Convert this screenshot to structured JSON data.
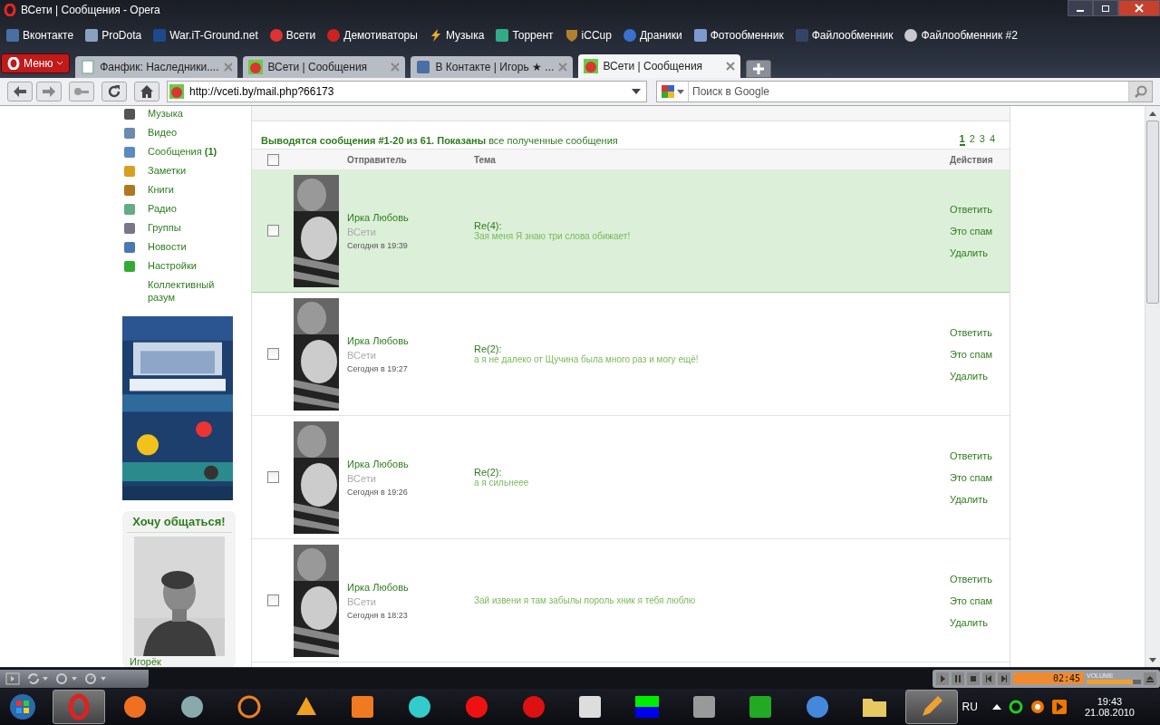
{
  "window": {
    "title": "ВСети | Сообщения - Opera"
  },
  "bookmarks": [
    {
      "label": "Вконтакте"
    },
    {
      "label": "ProDota"
    },
    {
      "label": "War.iT-Ground.net"
    },
    {
      "label": "Всети"
    },
    {
      "label": "Демотиваторы"
    },
    {
      "label": "Музыка"
    },
    {
      "label": "Торрент"
    },
    {
      "label": "iCCup"
    },
    {
      "label": "Драники"
    },
    {
      "label": "Фотообменник"
    },
    {
      "label": "Файлообменник"
    },
    {
      "label": "Файлообменник #2"
    }
  ],
  "menu_button": {
    "label": "Меню"
  },
  "tabs": [
    {
      "title": "Фанфик: Наследники....",
      "selected": false
    },
    {
      "title": "ВСети | Сообщения",
      "selected": false
    },
    {
      "title": "В Контакте | Игорь ★ ...",
      "selected": false
    },
    {
      "title": "ВСети | Сообщения",
      "selected": true
    }
  ],
  "address_bar": {
    "url": "http://vceti.by/mail.php?66173"
  },
  "search": {
    "placeholder": "Поиск в Google"
  },
  "sidebar": {
    "items": [
      {
        "label": "Музыка"
      },
      {
        "label": "Видео"
      },
      {
        "label": "Сообщения **(1)**"
      },
      {
        "label": "Заметки"
      },
      {
        "label": "Книги"
      },
      {
        "label": "Радио"
      },
      {
        "label": "Группы"
      },
      {
        "label": "Новости"
      },
      {
        "label": "Настройки"
      },
      {
        "label": "Коллективный разум"
      }
    ]
  },
  "promo": {
    "title": "Хочу общаться!",
    "name": "Игорёк"
  },
  "messages": {
    "summary": "**Выводятся сообщения #1-20 из 61. Показаны** все полученные сообщения",
    "pages": [
      {
        "label": "1",
        "selected": true
      },
      {
        "label": "2",
        "selected": false
      },
      {
        "label": "3",
        "selected": false
      },
      {
        "label": "4",
        "selected": false
      }
    ],
    "select_all_checked": false,
    "columns": [
      "Отправитель",
      "Тема",
      "Действия"
    ],
    "rows": [
      {
        "unread": true,
        "checked": false,
        "sender": "Ирка Любовь",
        "network": "ВСети",
        "date": "Сегодня в 19:39",
        "subject": "Re(4):",
        "text": "Зая меня Я знаю три слова обижает!",
        "actions": [
          "Ответить",
          "Это спам",
          "Удалить"
        ]
      },
      {
        "unread": false,
        "checked": false,
        "sender": "Ирка Любовь",
        "network": "ВСети",
        "date": "Сегодня в 19:27",
        "subject": "Re(2):",
        "text": "а я не далеко от Щучина была много раз и могу ещё!",
        "actions": [
          "Ответить",
          "Это спам",
          "Удалить"
        ]
      },
      {
        "unread": false,
        "checked": false,
        "sender": "Ирка Любовь",
        "network": "ВСети",
        "date": "Сегодня в 19:26",
        "subject": "Re(2):",
        "text": "а я сильнеее",
        "actions": [
          "Ответить",
          "Это спам",
          "Удалить"
        ]
      },
      {
        "unread": false,
        "checked": false,
        "sender": "Ирка Любовь",
        "network": "ВСети",
        "date": "Сегодня в 18:23",
        "text": "Зай извени я там забылы пороль хник я тебя люблю",
        "actions": [
          "Ответить",
          "Это спам",
          "Удалить"
        ]
      }
    ]
  },
  "media_player": {
    "time": "02:45",
    "volume_label": "VOLUME",
    "volume": {
      "level": 0.85
    }
  },
  "taskbar": {
    "apps": [
      {
        "active": true
      },
      {
        "active": false
      },
      {
        "active": false
      },
      {
        "active": false
      },
      {
        "active": false
      },
      {
        "active": false
      },
      {
        "active": false
      },
      {
        "active": false
      },
      {
        "active": false
      },
      {
        "active": false
      },
      {
        "active": false
      },
      {
        "active": false
      },
      {
        "active": false
      },
      {
        "active": false
      },
      {
        "active": false
      },
      {
        "active": true
      }
    ],
    "language": "RU",
    "time": "19:43",
    "date": "21.08.2010"
  }
}
